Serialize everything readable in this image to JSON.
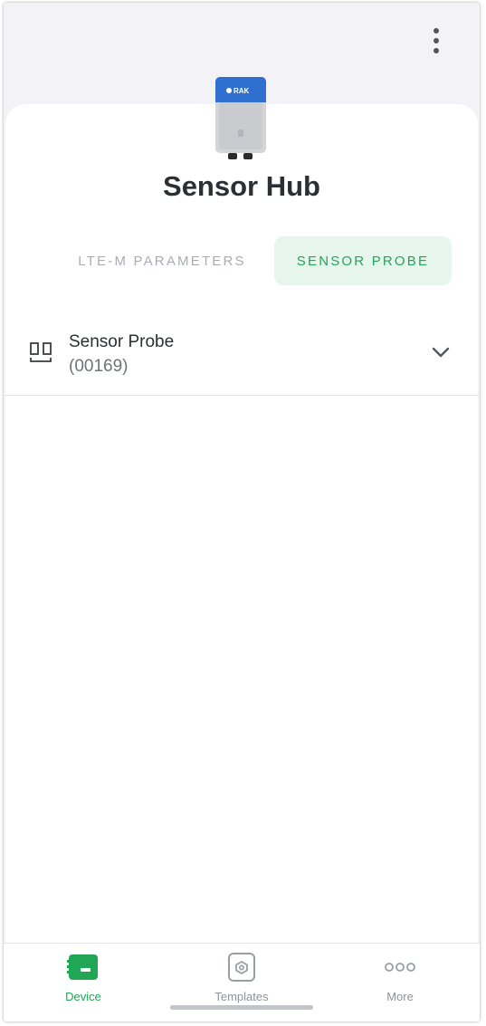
{
  "header": {
    "menu_icon": "more-vertical-icon",
    "device_image": "rak-sensor-hub-device",
    "device_logo_text": "RAK",
    "title": "Sensor Hub"
  },
  "tabs": [
    {
      "label": "LTE-M PARAMETERS",
      "active": false
    },
    {
      "label": "SENSOR PROBE",
      "active": true
    }
  ],
  "probe": {
    "icon": "probe-icon",
    "name": "Sensor Probe",
    "id": "(00169)",
    "expand_icon": "chevron-down-icon"
  },
  "bottom_nav": [
    {
      "label": "Device",
      "icon": "device-icon",
      "active": true
    },
    {
      "label": "Templates",
      "icon": "templates-icon",
      "active": false
    },
    {
      "label": "More",
      "icon": "more-horizontal-icon",
      "active": false
    }
  ],
  "colors": {
    "accent": "#23a45a",
    "active_tab_bg": "#e6f6ec",
    "device_blue": "#2f6fd0"
  }
}
